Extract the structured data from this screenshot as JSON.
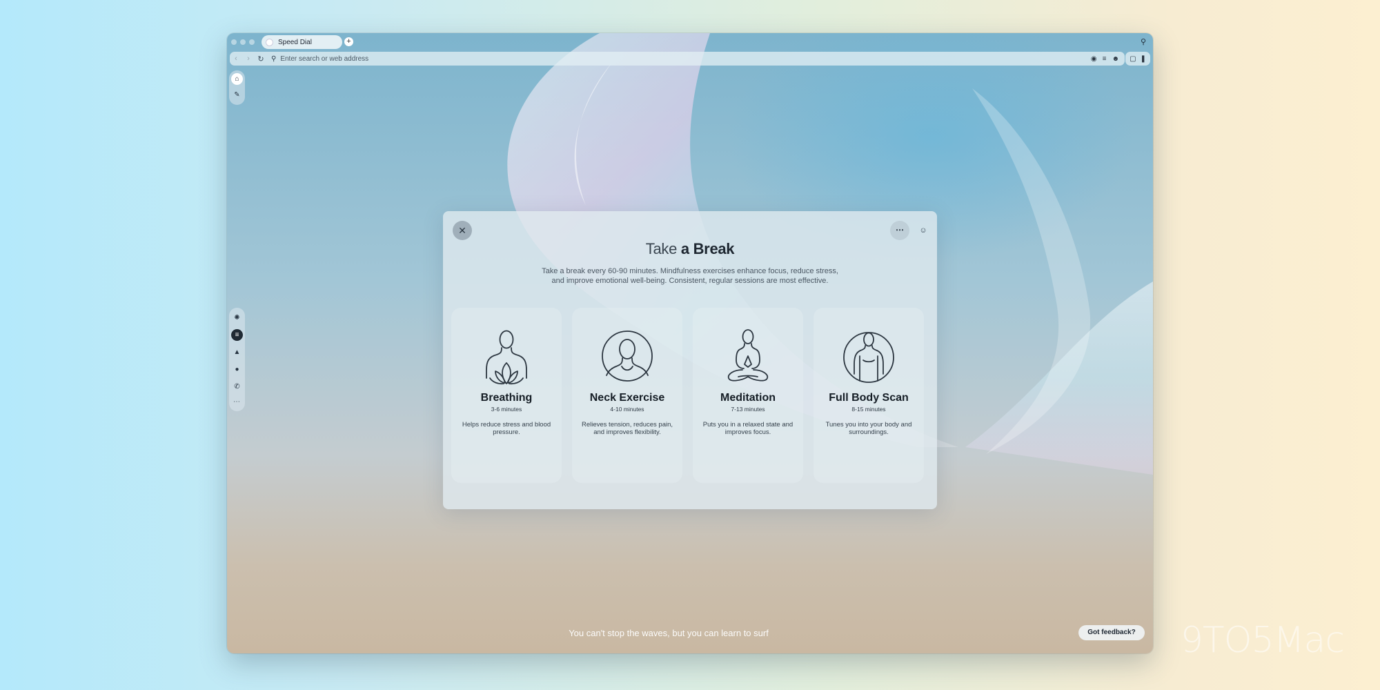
{
  "watermark": "9TO5Mac",
  "browser": {
    "tab_label": "Speed Dial",
    "new_tab_symbol": "+",
    "address_placeholder": "Enter search or web address"
  },
  "break_dialog": {
    "title_light": "Take",
    "title_bold": "a Break",
    "description_line1": "Take a break every 60-90 minutes. Mindfulness exercises enhance focus, reduce stress,",
    "description_line2": "and improve emotional well-being. Consistent, regular sessions are most effective.",
    "exercises": [
      {
        "name": "Breathing",
        "duration": "3-6 minutes",
        "description": "Helps reduce stress and blood pressure."
      },
      {
        "name": "Neck Exercise",
        "duration": "4-10 minutes",
        "description": "Relieves tension, reduces pain, and improves flexibility."
      },
      {
        "name": "Meditation",
        "duration": "7-13 minutes",
        "description": "Puts you in a relaxed state and improves focus."
      },
      {
        "name": "Full Body Scan",
        "duration": "8-15 minutes",
        "description": "Tunes you into your body and surroundings."
      }
    ]
  },
  "quote": "You can't stop the waves, but you can learn to surf",
  "feedback_label": "Got feedback?"
}
